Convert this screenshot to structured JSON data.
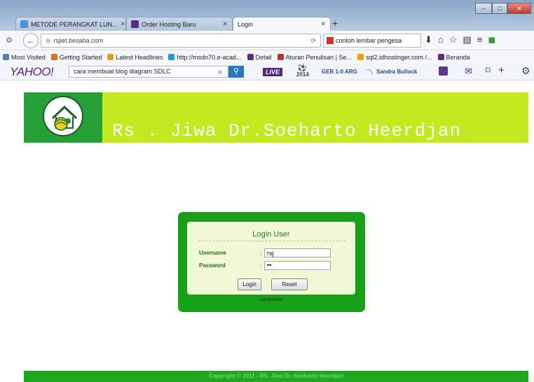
{
  "browser": {
    "tabs": [
      {
        "label": "METODE PERANGKAT LUN...",
        "color": "#4a8fd8"
      },
      {
        "label": "Order Hosting Baru",
        "color": "#5a2a8c"
      },
      {
        "label": "Login",
        "color": "#ffffff"
      }
    ],
    "address": "rsjiet.besaba.com",
    "search_value": "contoh lembar pengesa",
    "bookmarks": [
      {
        "label": "Most Visited",
        "color": "#4a7fc1"
      },
      {
        "label": "Getting Started",
        "color": "#e07020"
      },
      {
        "label": "Latest Headlines",
        "color": "#e0a020"
      },
      {
        "label": "http://msdn70.e-acad...",
        "color": "#1a9ad6"
      },
      {
        "label": "Detail",
        "color": "#5a2a8c"
      },
      {
        "label": "Aturan Penulisan | Se...",
        "color": "#c03030"
      },
      {
        "label": "sql2.idhostinger.com /...",
        "color": "#f0a000"
      },
      {
        "label": "Beranda",
        "color": "#5a2a8c"
      }
    ]
  },
  "yahoo": {
    "logo": "YAHOO!",
    "search_value": "cara membuat blog diagram SDLC",
    "live": "LIVE",
    "wc": "GER 1-0 ARG",
    "wc_year": "2014",
    "person": "Sandra Bullock"
  },
  "page": {
    "title": "Rs . Jiwa Dr.Soeharto Heerdjan",
    "login": {
      "heading": "Login User",
      "username_label": "Username",
      "password_label": "Password",
      "colon": ":",
      "username_value": "rsj",
      "password_value": "••",
      "login_button": "Login",
      "reset_button": "Reset",
      "continue_link": "Lanjutkan"
    },
    "footer": "Copyright © 2011 - RS. Jiwa Dr. Soeharto Heerdjan"
  }
}
